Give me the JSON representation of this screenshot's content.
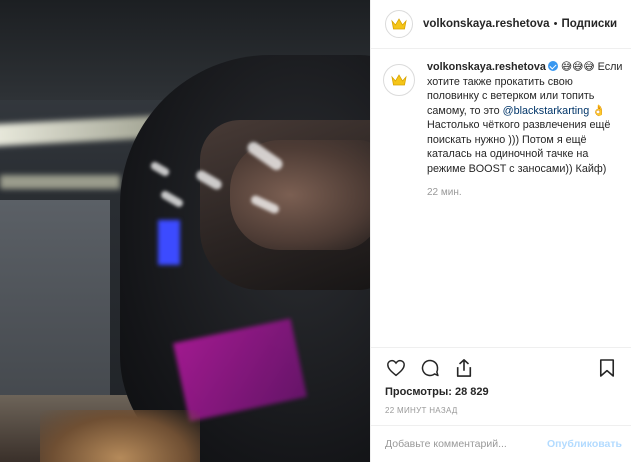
{
  "post": {
    "username": "volkonskaya.reshetova",
    "separator": "•",
    "follow_label": "Подписки"
  },
  "caption": {
    "author": "volkonskaya.reshetova",
    "emoji": "😅😅😅",
    "text_before_mention": "Если хотите также прокатить свою половинку с ветерком или топить самому, то это",
    "mention": "@blackstarkarting",
    "mention_emoji": "👌",
    "text_after_mention": "Настолько чёткого развлечения ещё поискать нужно ))) Потом я ещё каталась на одиночной тачке на режиме BOOST с заносами)) Кайф)",
    "time_ago": "22 мин."
  },
  "stats": {
    "views_label": "Просмотры:",
    "views_count": "28 829",
    "date": "22 МИНУТ НАЗАД"
  },
  "comment_box": {
    "placeholder": "Добавьте комментарий...",
    "publish_label": "Опубликовать"
  },
  "colors": {
    "brand_crown": "#f5c518",
    "avatar_ring": "#c13584",
    "verified": "#3897f0",
    "mention": "#003569",
    "publish_disabled": "#b3dbff"
  },
  "icons": [
    "heart-icon",
    "comment-icon",
    "share-icon",
    "bookmark-icon",
    "crown-icon",
    "verified-icon"
  ]
}
